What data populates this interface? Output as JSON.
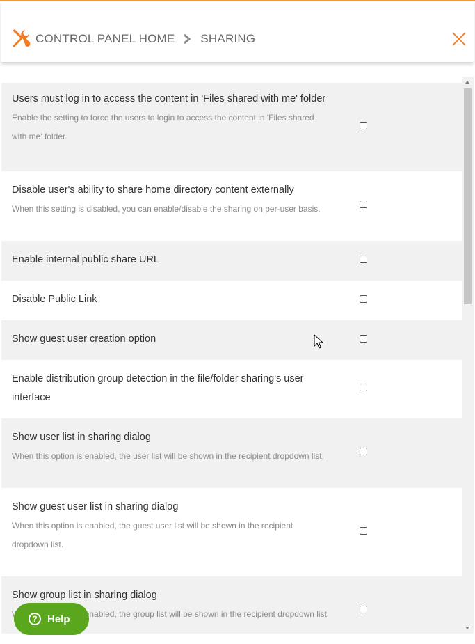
{
  "header": {
    "breadcrumb_home": "CONTROL PANEL HOME",
    "breadcrumb_current": "SHARING",
    "accent_color": "#f37b22"
  },
  "settings": [
    {
      "title": "Users must log in to access the content in 'Files shared with me' folder",
      "desc_line1": "Enable the setting to force the users to login to access the content in 'Files shared",
      "desc_line2": "with me' folder.",
      "checked": false
    },
    {
      "title": "Disable user's ability to share home directory content externally",
      "desc": "When this setting is disabled, you can enable/disable the sharing on per-user basis.",
      "checked": false
    },
    {
      "title": "Enable internal public share URL",
      "checked": false
    },
    {
      "title": "Disable Public Link",
      "checked": false
    },
    {
      "title": "Show guest user creation option",
      "checked": false
    },
    {
      "title_line1": "Enable distribution group detection in the file/folder sharing's user",
      "title_line2": "interface",
      "checked": false
    },
    {
      "title": "Show user list in sharing dialog",
      "desc": "When this option is enabled, the user list will be shown in the recipient dropdown list.",
      "checked": false
    },
    {
      "title": "Show guest user list in sharing dialog",
      "desc_line1": "When this option is enabled, the guest user list will be shown in the recipient",
      "desc_line2": "dropdown list.",
      "checked": false
    },
    {
      "title": "Show group list in sharing dialog",
      "desc": "When this option is enabled, the group list will be shown in the recipient dropdown list.",
      "checked": false
    }
  ],
  "help": {
    "label": "Help",
    "color": "#5aa61c"
  },
  "icons": {
    "logo": "tools-icon",
    "separator": "chevron-right-icon",
    "close": "close-icon",
    "help": "question-circle-icon"
  }
}
